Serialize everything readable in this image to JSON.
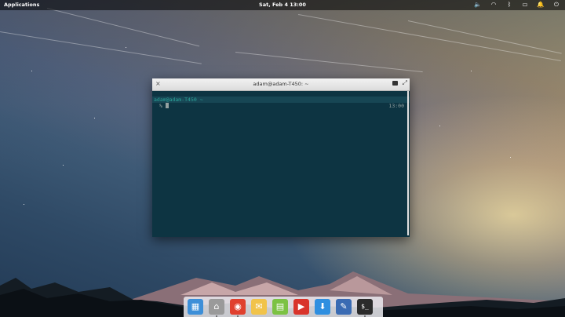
{
  "top_panel": {
    "applications_label": "Applications",
    "clock": "Sat, Feb  4   13:00",
    "tray_icons": [
      "volume-icon",
      "wifi-icon",
      "bluetooth-icon",
      "battery-icon",
      "notifications-icon",
      "power-icon"
    ]
  },
  "terminal": {
    "title": "adam@adam-T450: ~",
    "prompt_user": "adam@adam-T450",
    "prompt_dir": " ~",
    "prompt_symbol": "%",
    "right_time": "13:00",
    "colors": {
      "background": "#0d3442",
      "accent": "#2aa198",
      "text": "#93a1a1"
    }
  },
  "dock": {
    "items": [
      {
        "name": "multitasking-view",
        "icon": "multitasking-icon",
        "color": "#3d8fd8",
        "glyph": "▦"
      },
      {
        "name": "files",
        "icon": "folder-icon",
        "color": "#9a9a9a",
        "glyph": "⌂"
      },
      {
        "name": "chrome",
        "icon": "chrome-icon",
        "color": "#e0402e",
        "glyph": "◉"
      },
      {
        "name": "mail",
        "icon": "mail-icon",
        "color": "#f1c34a",
        "glyph": "✉"
      },
      {
        "name": "calendar",
        "icon": "calendar-icon",
        "color": "#7cc243",
        "glyph": "▤"
      },
      {
        "name": "videos",
        "icon": "video-icon",
        "color": "#d9342b",
        "glyph": "▶"
      },
      {
        "name": "appcenter",
        "icon": "download-icon",
        "color": "#2f8fe0",
        "glyph": "⬇"
      },
      {
        "name": "code-editor",
        "icon": "editor-icon",
        "color": "#3a6bb3",
        "glyph": "✎"
      },
      {
        "name": "terminal",
        "icon": "terminal-icon",
        "color": "#2b2b2b",
        "glyph": "$_"
      }
    ]
  }
}
